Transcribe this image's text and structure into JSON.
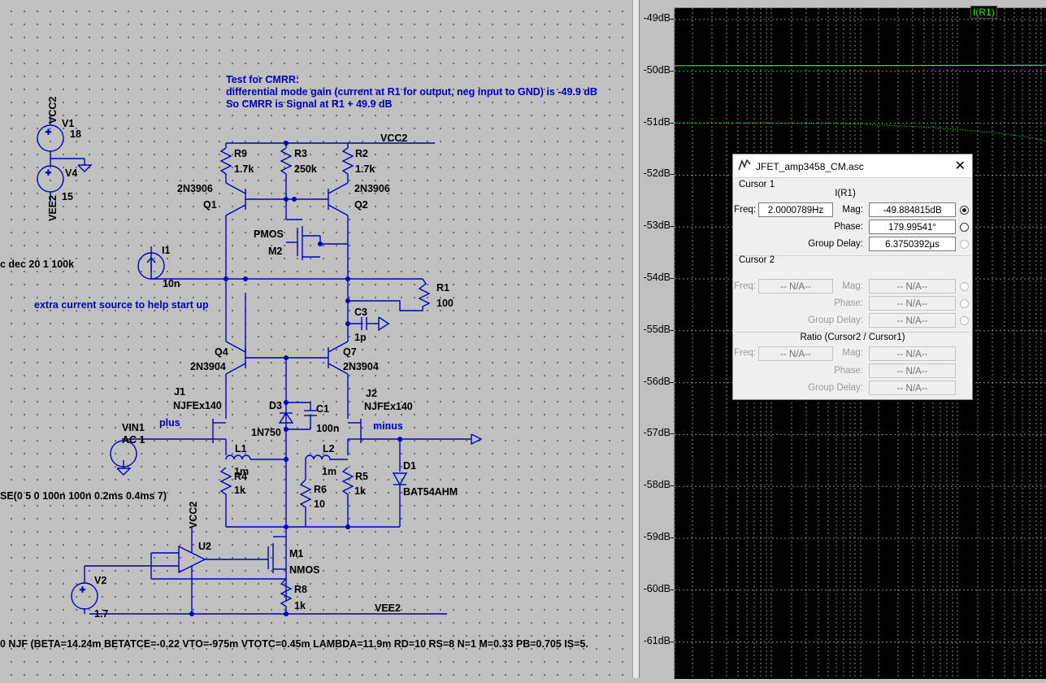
{
  "schematic": {
    "comments": [
      "Test for CMRR:",
      "differential mode gain (current at R1 for output, neg input to GND) is -49.9 dB",
      "So CMRR is Signal at R1 + 49.9 dB"
    ],
    "start_note": "extra current source to help start up",
    "ac_directive": "c dec 20 1 100k",
    "pulse_directive": "SE(0 5 0 100n 100n 0.2ms 0.4ms 7)",
    "model_directive": "0 NJF (BETA=14.24m BETATCE=-0.22 VTO=-975m VTOTC=0.45m LAMBDA=11.9m RD=10 RS=8 N=1 M=0.33 PB=0.705 IS=5.",
    "nets": {
      "vcc": "VCC2",
      "vee": "VEE2",
      "plus": "plus",
      "minus": "minus"
    },
    "parts": {
      "V1": "V1",
      "V1_val": "18",
      "V4": "V4",
      "V4_val": "15",
      "V2": "V2",
      "V2_val": "1.7",
      "I1": "I1",
      "I1_val": "10n",
      "R9": "R9",
      "R9_val": "1.7k",
      "R3": "R3",
      "R3_val": "250k",
      "R2": "R2",
      "R2_val": "1.7k",
      "R1": "R1",
      "R1_val": "100",
      "R4": "R4",
      "R4_val": "1k",
      "R5": "R5",
      "R5_val": "1k",
      "R6": "R6",
      "R6_val": "10",
      "R8": "R8",
      "R8_val": "1k",
      "Q1": "Q1",
      "Q1_model": "2N3906",
      "Q2": "Q2",
      "Q2_model": "2N3906",
      "Q4": "Q4",
      "Q4_model": "2N3904",
      "Q7": "Q7",
      "Q7_model": "2N3904",
      "M2": "M2",
      "M2_model": "PMOS",
      "M1": "M1",
      "M1_model": "NMOS",
      "C3": "C3",
      "C3_val": "1p",
      "C1": "C1",
      "C1_val": "100n",
      "D3": "D3",
      "D3_model": "1N750",
      "D1": "D1",
      "D1_model": "BAT54AHM",
      "J1": "J1",
      "J1_model": "NJFEx140",
      "J2": "J2",
      "J2_model": "NJFEx140",
      "L1": "L1",
      "L1_val": "1m",
      "L2": "L2",
      "L2_val": "1m",
      "VIN1": "VIN1",
      "VIN1_val": "AC 1",
      "U2": "U2"
    }
  },
  "plot": {
    "trace_label": "I(R1)",
    "y_ticks": [
      "-49dB",
      "-50dB",
      "-51dB",
      "-52dB",
      "-53dB",
      "-54dB",
      "-55dB",
      "-56dB",
      "-57dB",
      "-58dB",
      "-59dB",
      "-60dB",
      "-61dB"
    ],
    "y_range": [
      -61.5,
      -48.8
    ],
    "trace_color": "#00ff00"
  },
  "cursor_dialog": {
    "title": "JFET_amp3458_CM.asc",
    "close_glyph": "✕",
    "cursor1_label": "Cursor 1",
    "trace": "I(R1)",
    "freq_label": "Freq:",
    "freq": "2.0000789Hz",
    "mag_label": "Mag:",
    "mag": "-49.884815dB",
    "phase_label": "Phase:",
    "phase": "179.99541°",
    "gd_label": "Group Delay:",
    "gd": "6.3750392µs",
    "cursor2_label": "Cursor 2",
    "na": "-- N/A--",
    "ratio_label": "Ratio (Cursor2 / Cursor1)"
  }
}
